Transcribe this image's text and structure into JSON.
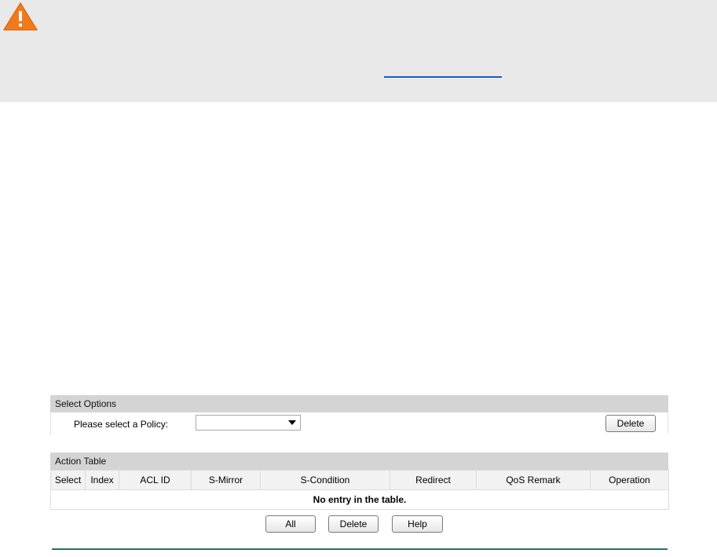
{
  "colors": {
    "banner_bg": "#e9e9e9",
    "warning_icon": "#f07b1d",
    "link": "#1a5dc8",
    "section_header_bg": "#d4d4d4",
    "divider": "#2e6f63"
  },
  "icons": {
    "warning": "warning-triangle-icon",
    "dropdown": "chevron-down-icon"
  },
  "select_options": {
    "header": "Select Options",
    "policy_label": "Please select a Policy:",
    "policy_value": "",
    "delete_label": "Delete"
  },
  "action_table": {
    "header": "Action Table",
    "columns": [
      "Select",
      "Index",
      "ACL ID",
      "S-Mirror",
      "S-Condition",
      "Redirect",
      "QoS Remark",
      "Operation"
    ],
    "empty_message": "No entry in the table."
  },
  "footer_buttons": {
    "all": "All",
    "delete": "Delete",
    "help": "Help"
  }
}
